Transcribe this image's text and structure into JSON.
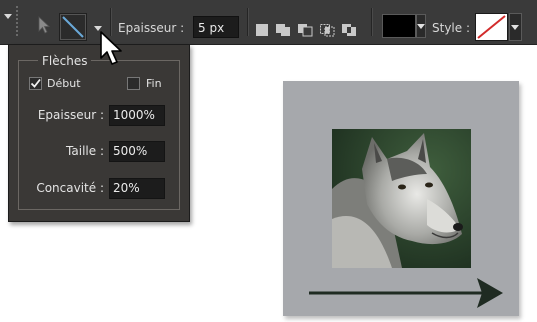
{
  "toolbar": {
    "thickness_label": "Epaisseur :",
    "thickness_value": "5 px",
    "style_label": "Style :"
  },
  "arrows_panel": {
    "title": "Flèches",
    "start_label": "Début",
    "start_checked": true,
    "end_label": "Fin",
    "end_checked": false,
    "thickness_label": "Epaisseur :",
    "thickness_value": "1000%",
    "size_label": "Taille :",
    "size_value": "500%",
    "concavity_label": "Concavité :",
    "concavity_value": "20%"
  },
  "colors": {
    "toolbar_bg": "#3a3a3a",
    "panel_bg": "#3a3836",
    "line_color": "#000000",
    "style_none_red": "#d22b2b",
    "card_bg": "#a6a8ac",
    "arrow_color": "#1f2b22"
  }
}
